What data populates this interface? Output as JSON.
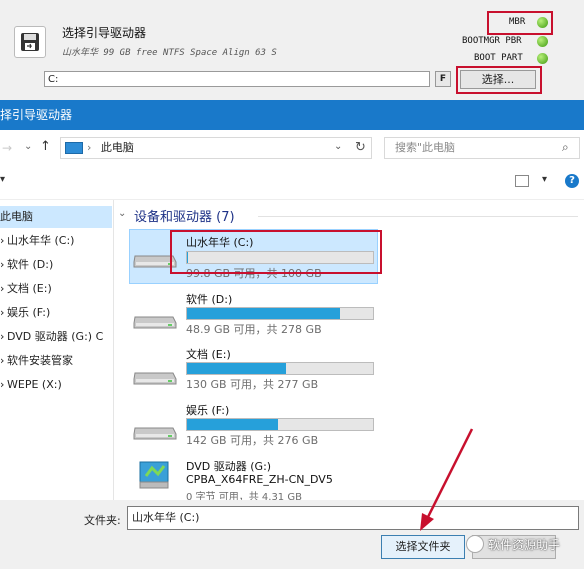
{
  "tool": {
    "title": "选择引导驱动器",
    "subtitle": "山水年华 99 GB free NTFS Space Align 63 S",
    "path_value": "C:",
    "f_label": "F",
    "choose_label": "选择...",
    "options": [
      "MBR",
      "BOOTMGR PBR",
      "BOOT PART"
    ]
  },
  "dialog": {
    "title": "择引导驱动器",
    "breadcrumb": "此电脑",
    "search_placeholder": "搜索\"此电脑",
    "section_title": "设备和驱动器 (7)",
    "nav_items": [
      {
        "label": "此电脑",
        "selected": true
      },
      {
        "label": "山水年华 (C:)"
      },
      {
        "label": "软件 (D:)"
      },
      {
        "label": "文档 (E:)"
      },
      {
        "label": "娱乐 (F:)"
      },
      {
        "label": "DVD 驱动器 (G:) C"
      },
      {
        "label": "软件安装管家"
      },
      {
        "label": "WEPE (X:)"
      }
    ],
    "drives": [
      {
        "name": "山水年华 (C:)",
        "capacity": "99.8 GB 可用，共 100 GB",
        "used_fraction": 0.002
      },
      {
        "name": "软件 (D:)",
        "capacity": "48.9 GB 可用，共 278 GB",
        "used_fraction": 0.82
      },
      {
        "name": "文档 (E:)",
        "capacity": "130 GB 可用，共 277 GB",
        "used_fraction": 0.53
      },
      {
        "name": "娱乐 (F:)",
        "capacity": "142 GB 可用，共 276 GB",
        "used_fraction": 0.49
      }
    ],
    "dvd": {
      "name": "DVD 驱动器 (G:)",
      "label": "CPBA_X64FRE_ZH-CN_DV5",
      "capacity": "0 字节 可用，共 4.31 GB"
    },
    "filename_label": "文件夹:",
    "filename_value": "山水年华 (C:)",
    "select_button": "选择文件夹"
  },
  "watermark": "软件资源助手",
  "colors": {
    "accent": "#1979ca",
    "highlight": "#c8102e",
    "bar_fill": "#26a0da"
  }
}
